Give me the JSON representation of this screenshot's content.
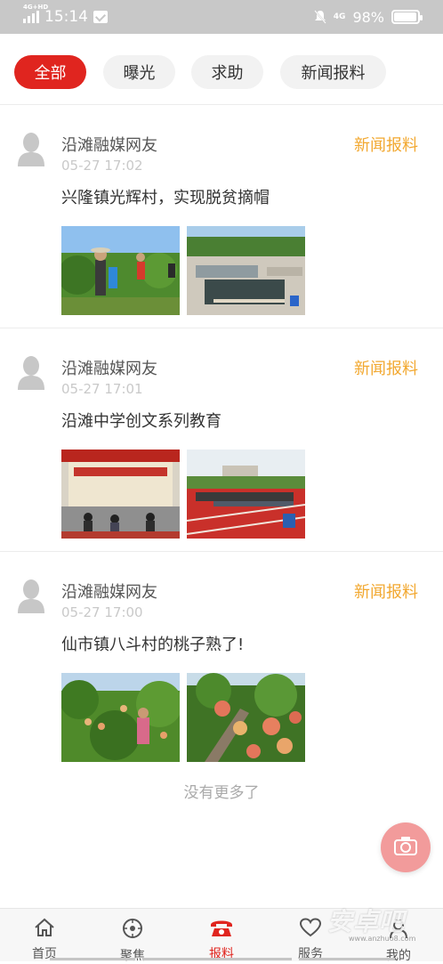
{
  "status_bar": {
    "network": "4G+HD",
    "time": "15:14",
    "network_right": "4G",
    "battery_percent": "98%",
    "battery_level": 0.98
  },
  "filter_tabs": [
    {
      "label": "全部",
      "active": true
    },
    {
      "label": "曝光",
      "active": false
    },
    {
      "label": "求助",
      "active": false
    },
    {
      "label": "新闻报料",
      "active": false
    }
  ],
  "posts": [
    {
      "author": "沿滩融媒网友",
      "time": "05-27 17:02",
      "category": "新闻报料",
      "title": "兴隆镇光辉村，实现脱贫摘帽"
    },
    {
      "author": "沿滩融媒网友",
      "time": "05-27 17:01",
      "category": "新闻报料",
      "title": "沿滩中学创文系列教育"
    },
    {
      "author": "沿滩融媒网友",
      "time": "05-27 17:00",
      "category": "新闻报料",
      "title": "仙市镇八斗村的桃子熟了!"
    }
  ],
  "no_more_text": "没有更多了",
  "bottom_nav": [
    {
      "label": "首页",
      "icon": "home-icon"
    },
    {
      "label": "聚焦",
      "icon": "focus-icon"
    },
    {
      "label": "报料",
      "icon": "phone-icon",
      "active": true
    },
    {
      "label": "服务",
      "icon": "heart-icon"
    },
    {
      "label": "我的",
      "icon": "user-icon"
    }
  ],
  "colors": {
    "accent_red": "#e0251f",
    "category_orange": "#f2a830",
    "fab_pink": "#f29b9b"
  },
  "watermark": "安卓吧",
  "watermark_sub": "www.anzhuo8.com"
}
